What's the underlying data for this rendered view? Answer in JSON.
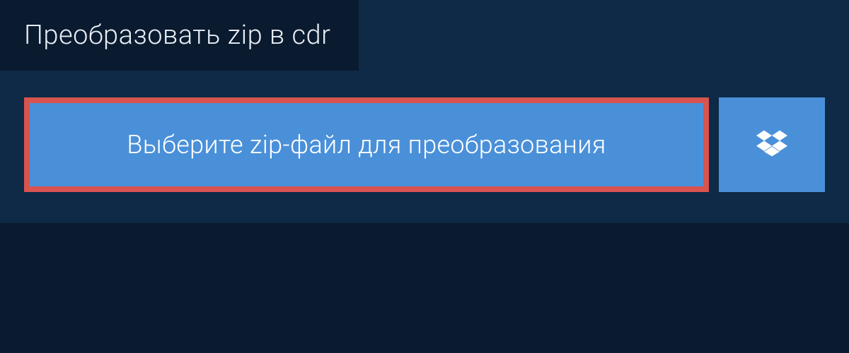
{
  "tab": {
    "title": "Преобразовать zip в cdr"
  },
  "upload": {
    "select_label": "Выберите zip-файл для преобразования"
  },
  "colors": {
    "bg_outer": "#0a1a2f",
    "bg_panel": "#0e2a47",
    "button_blue": "#4a90d9",
    "highlight_red": "#d9534f",
    "text_light": "#e8eef5"
  }
}
